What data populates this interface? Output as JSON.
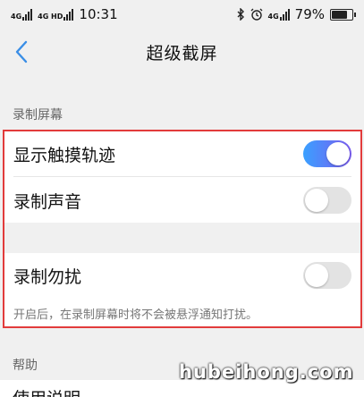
{
  "status_bar": {
    "left_net_1": "4G",
    "left_net_2": "4G HD",
    "time": "10:31",
    "right_net": "4G",
    "battery_text": "79%",
    "battery_level": 0.79,
    "icons": [
      "bluetooth-icon",
      "alarm-icon",
      "signal-icon",
      "battery-icon"
    ]
  },
  "nav": {
    "title": "超级截屏",
    "back_icon": "chevron-left-icon"
  },
  "sections": {
    "record_label": "录制屏幕",
    "help_label": "帮助"
  },
  "settings": [
    {
      "label": "显示触摸轨迹",
      "enabled": true
    },
    {
      "label": "录制声音",
      "enabled": false
    },
    {
      "label": "录制勿扰",
      "enabled": false
    }
  ],
  "hint": "开启后，在录制屏幕时将不会被悬浮通知打扰。",
  "help_item": "使用说明",
  "watermark": "hubeihong.com",
  "colors": {
    "toggle_on_start": "#3aa0ff",
    "toggle_on_end": "#7b5cf0",
    "highlight_border": "#e23b3b",
    "back_arrow": "#3a8ee6"
  }
}
